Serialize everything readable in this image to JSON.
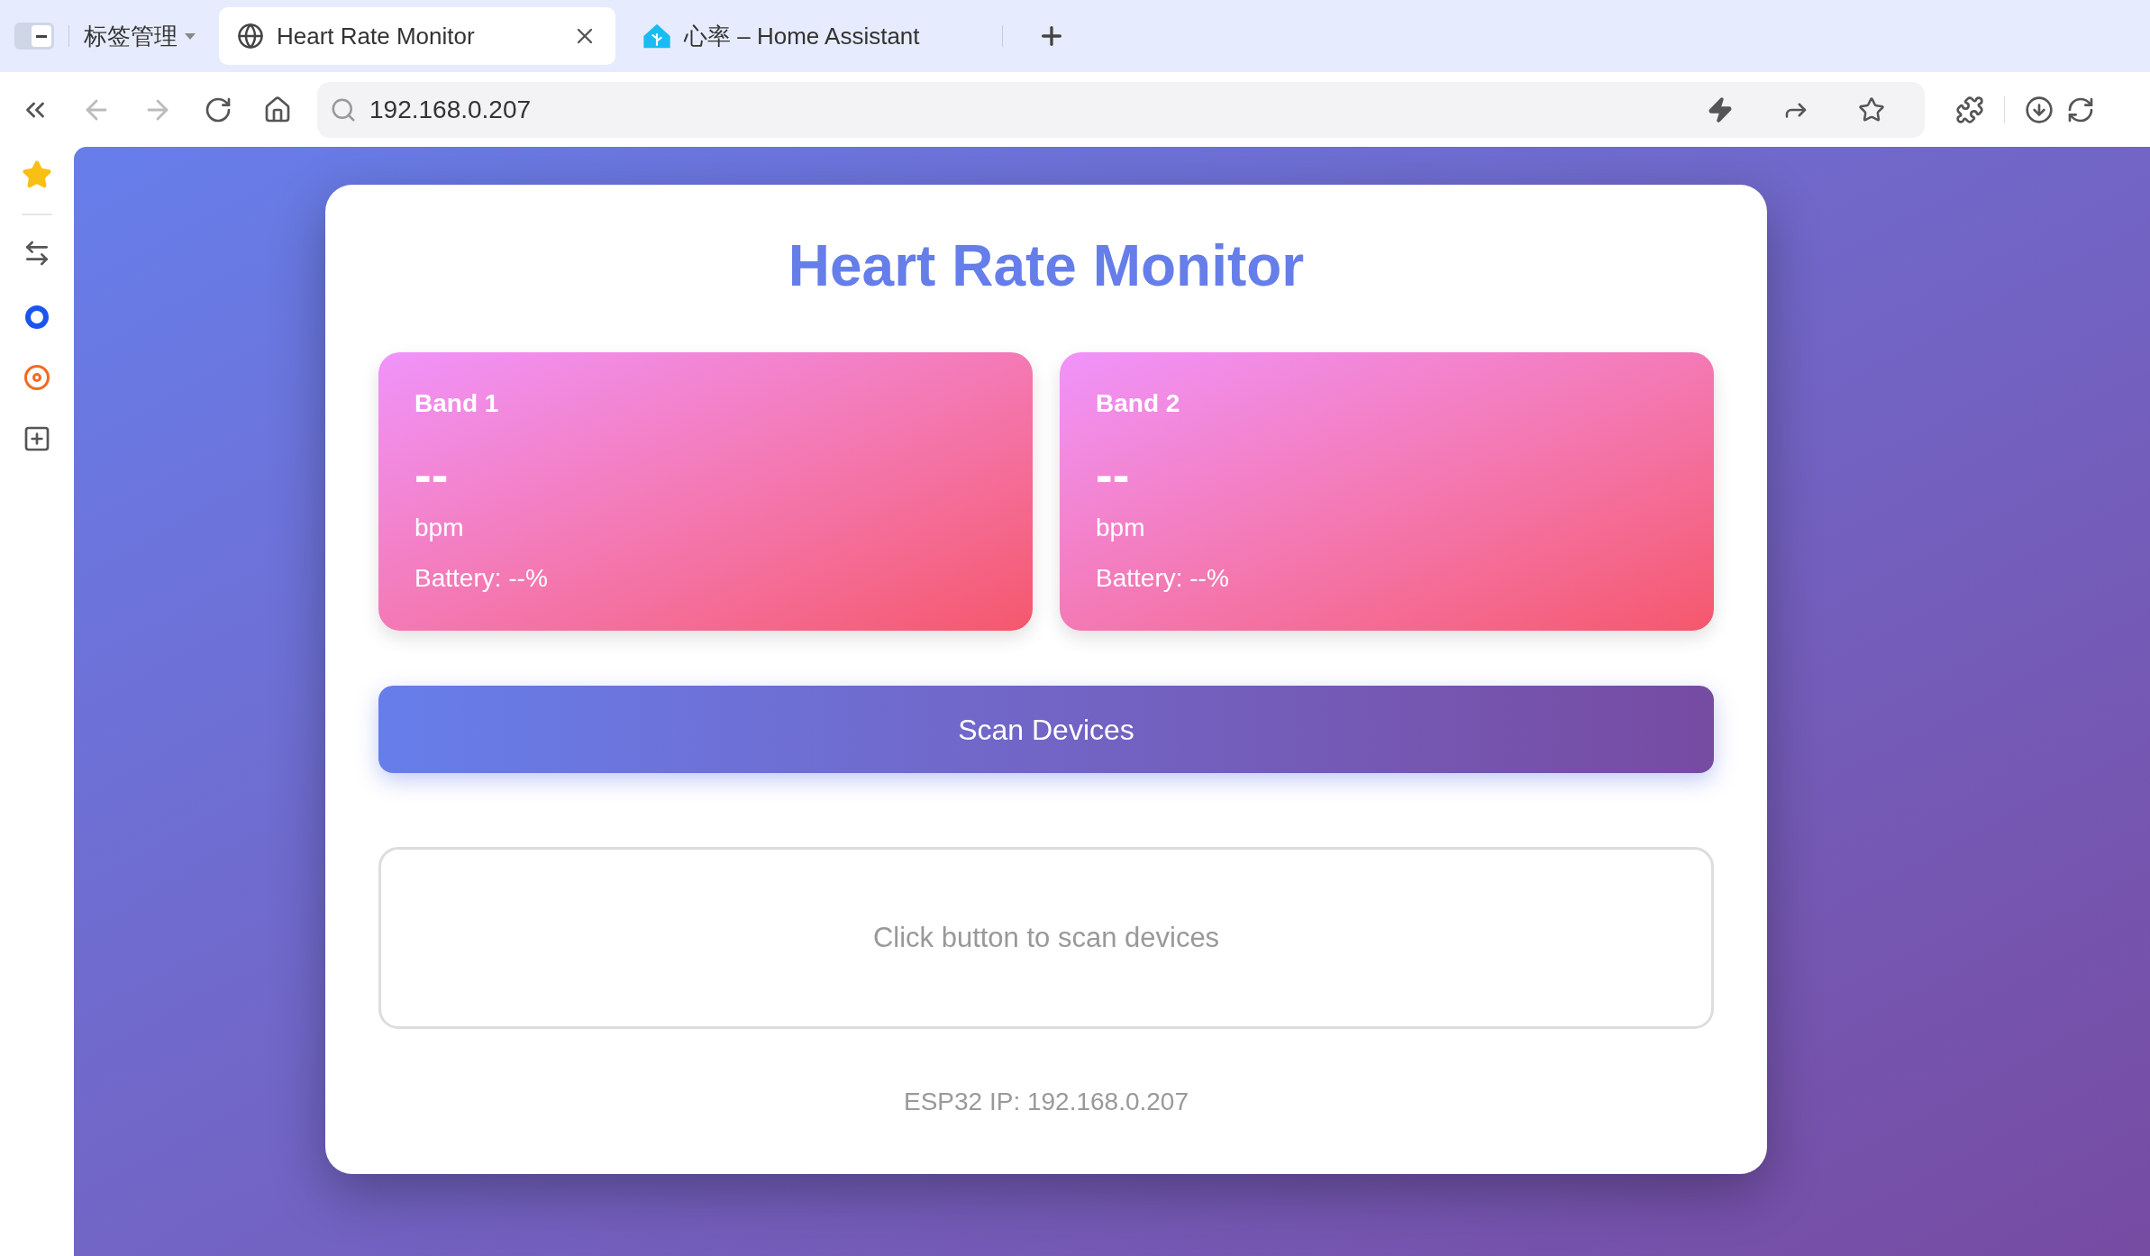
{
  "browser": {
    "tab_group": {
      "label": "标签管理"
    },
    "tabs": [
      {
        "title": "Heart Rate Monitor",
        "selected": true,
        "kind": "globe"
      },
      {
        "title": "心率 – Home Assistant",
        "selected": false,
        "kind": "home"
      }
    ],
    "address": "192.168.0.207"
  },
  "page": {
    "title": "Heart Rate Monitor",
    "bands": [
      {
        "name": "Band 1",
        "value": "--",
        "unit": "bpm",
        "battery": "Battery: --%"
      },
      {
        "name": "Band 2",
        "value": "--",
        "unit": "bpm",
        "battery": "Battery: --%"
      }
    ],
    "scan_button": "Scan Devices",
    "status": "Click button to scan devices",
    "footer": "ESP32 IP: 192.168.0.207"
  }
}
